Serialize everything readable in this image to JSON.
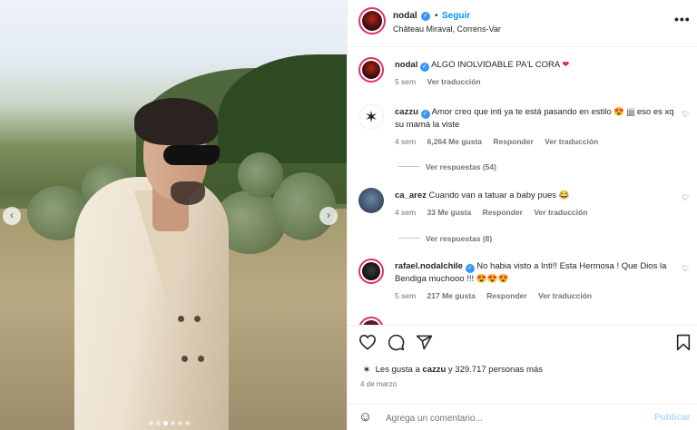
{
  "post": {
    "username": "nodal",
    "follow_label": "Seguir",
    "separator": "•",
    "location": "Château Miraval, Correns-Var",
    "more_label": "•••"
  },
  "carousel": {
    "prev": "‹",
    "next": "›"
  },
  "comments": [
    {
      "user": "nodal",
      "text": "ALGO INOLVIDABLE PA'L CORA",
      "emoji": "❤",
      "time": "5 sem",
      "translate": "Ver traducción"
    },
    {
      "user": "cazzu",
      "text": "Amor creo que inti ya te está pasando en estilo 😍 jjjj eso es xq su mamá la viste",
      "time": "4 sem",
      "likes": "6,264 Me gusta",
      "reply": "Responder",
      "translate": "Ver traducción",
      "replies": "Ver respuestas (54)"
    },
    {
      "user": "ca_arez",
      "text": "Cuando van a tatuar a baby pues 😂",
      "time": "4 sem",
      "likes": "33 Me gusta",
      "reply": "Responder",
      "translate": "Ver traducción",
      "replies": "Ver respuestas (8)"
    },
    {
      "user": "rafael.nodalchile",
      "text": "No habia visto a Inti!! Esta Hermosa ! Que Dios la Bendiga muchooo !!! 😍😍😍",
      "time": "5 sem",
      "likes": "217 Me gusta",
      "reply": "Responder",
      "translate": "Ver traducción"
    }
  ],
  "likes": {
    "prefix": "Les gusta a",
    "user": "cazzu",
    "suffix": "y 329.717 personas más"
  },
  "date": "4 de marzo",
  "composer": {
    "placeholder": "Agrega un comentario...",
    "publish": "Publicar"
  },
  "colors": {
    "accent": "#0095f6",
    "verified": "#3897f0",
    "ring": "#e1306c"
  },
  "icons": [
    "heart-icon",
    "comment-icon",
    "share-icon",
    "bookmark-icon",
    "more-icon",
    "emoji-icon",
    "verified-icon"
  ]
}
